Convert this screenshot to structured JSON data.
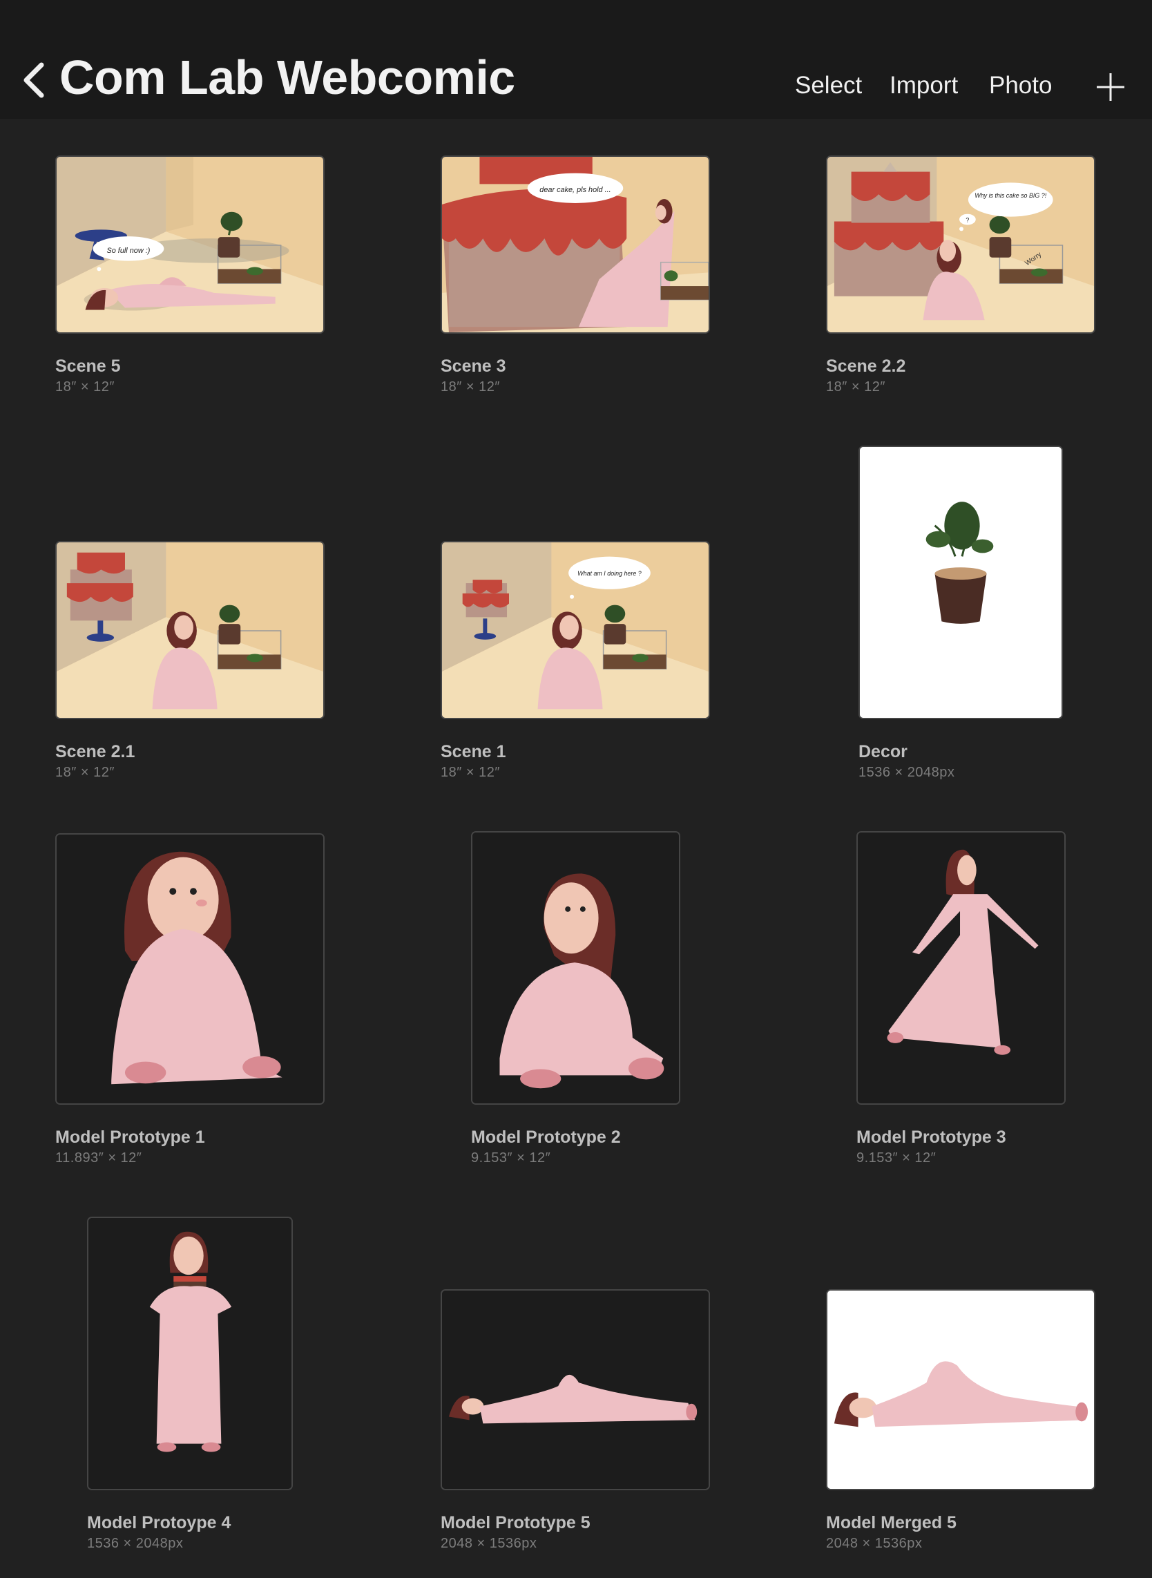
{
  "header": {
    "title": "Com Lab Webcomic",
    "actions": {
      "select": "Select",
      "import": "Import",
      "photo": "Photo"
    },
    "back_icon": "chevron-left-icon",
    "add_icon": "plus-icon"
  },
  "artworks": [
    {
      "name": "Scene 5",
      "dims": "18″ × 12″",
      "bubble": "So full now :)"
    },
    {
      "name": "Scene 3",
      "dims": "18″ × 12″",
      "bubble": "dear cake, pls hold ..."
    },
    {
      "name": "Scene 2.2",
      "dims": "18″ × 12″",
      "bubble": "Why is this cake so BIG ?!",
      "bubble2": "?",
      "note": "Worry"
    },
    {
      "name": "Scene 2.1",
      "dims": "18″ × 12″"
    },
    {
      "name": "Scene 1",
      "dims": "18″ × 12″",
      "bubble": "What am I doing here ?"
    },
    {
      "name": "Decor",
      "dims": "1536 × 2048px"
    },
    {
      "name": "Model Prototype 1",
      "dims": "11.893″ × 12″"
    },
    {
      "name": "Model Prototype 2",
      "dims": "9.153″ × 12″"
    },
    {
      "name": "Model Prototype 3",
      "dims": "9.153″ × 12″"
    },
    {
      "name": "Model Protoype 4",
      "dims": "1536 × 2048px"
    },
    {
      "name": "Model Prototype 5",
      "dims": "2048 × 1536px"
    },
    {
      "name": "Model Merged 5",
      "dims": "2048 × 1536px"
    }
  ],
  "colors": {
    "background": "#212121",
    "header": "#1a1a1a",
    "scene_wall": "#eccd9c",
    "cake_red": "#c4473b",
    "pajama_pink": "#eebfc4",
    "hair": "#6b2d28"
  }
}
